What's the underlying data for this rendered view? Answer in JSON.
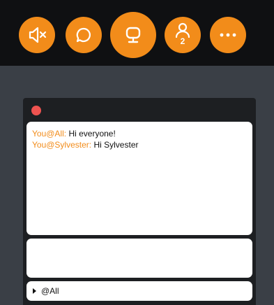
{
  "toolbar": {
    "buttons": [
      {
        "name": "mute",
        "icon": "speaker-muted-icon"
      },
      {
        "name": "chat",
        "icon": "chat-bubble-icon"
      },
      {
        "name": "screen",
        "icon": "monitor-icon"
      },
      {
        "name": "participants",
        "icon": "person-icon",
        "badge": "2"
      },
      {
        "name": "more",
        "icon": "more-dots-icon"
      }
    ]
  },
  "chat": {
    "messages": [
      {
        "sender": "You@All:",
        "text": "Hi everyone!"
      },
      {
        "sender": "You@Sylvester:",
        "text": "Hi Sylvester"
      }
    ],
    "recipient": "@All"
  },
  "colors": {
    "accent": "#f28c1a",
    "topbar": "#0f1012",
    "background": "#3a3f46",
    "panel": "#1d1f22",
    "close": "#ee5350"
  }
}
